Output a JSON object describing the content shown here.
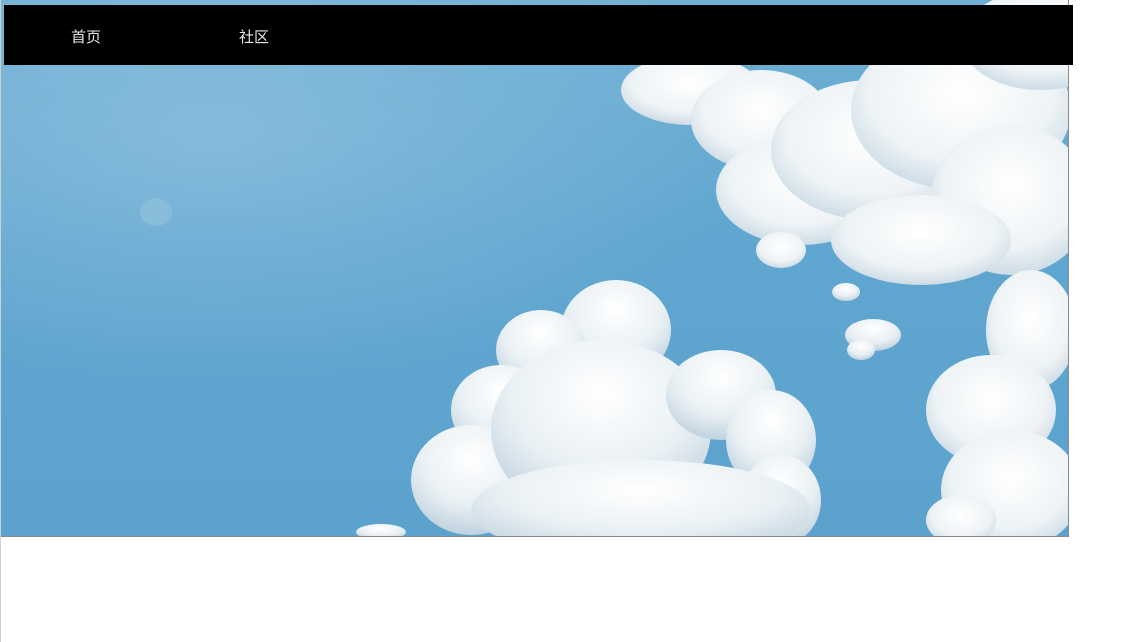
{
  "navbar": {
    "items": [
      {
        "label": "首页"
      },
      {
        "label": "社区"
      }
    ]
  },
  "hero": {
    "image": "blue-sky-with-clouds"
  },
  "colors": {
    "navbar_bg": "#000000",
    "nav_text": "#e8e8e8",
    "sky": "#5fa6d0",
    "cloud": "#f4f7f9"
  }
}
